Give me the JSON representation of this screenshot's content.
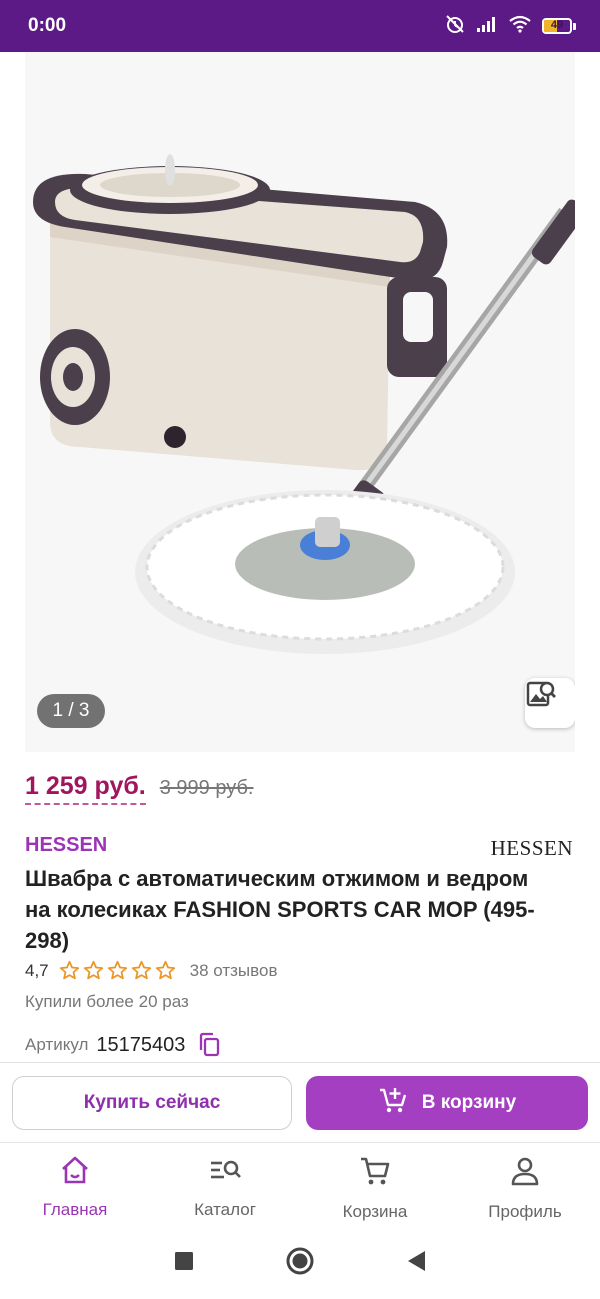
{
  "status_bar": {
    "time": "0:00",
    "battery": "49",
    "battery_level": 0.49
  },
  "gallery": {
    "indicator": "1 / 3"
  },
  "price": {
    "current": "1 259 руб.",
    "old": "3 999 руб."
  },
  "brand": {
    "link": "HESSEN",
    "logo": "HESSEN"
  },
  "product": {
    "title": "Швабра с автоматическим отжимом и ведром на колесиках FASHION SPORTS CAR MOP (495-298)",
    "rating": "4,7",
    "stars": 5,
    "reviews": "38 отзывов",
    "purchased": "Купили более 20 раз",
    "article_label": "Артикул",
    "article_value": "15175403"
  },
  "actions": {
    "buy_now": "Купить сейчас",
    "add_to_cart": "В корзину"
  },
  "bottom_nav": [
    {
      "label": "Главная",
      "icon": "home-icon",
      "active": true
    },
    {
      "label": "Каталог",
      "icon": "catalog-search-icon",
      "active": false
    },
    {
      "label": "Корзина",
      "icon": "cart-icon",
      "active": false
    },
    {
      "label": "Профиль",
      "icon": "profile-icon",
      "active": false
    }
  ],
  "colors": {
    "status_bar": "#5b1a86",
    "accent": "#a33fc0",
    "price": "#a1145e",
    "brand": "#9b35b5"
  }
}
